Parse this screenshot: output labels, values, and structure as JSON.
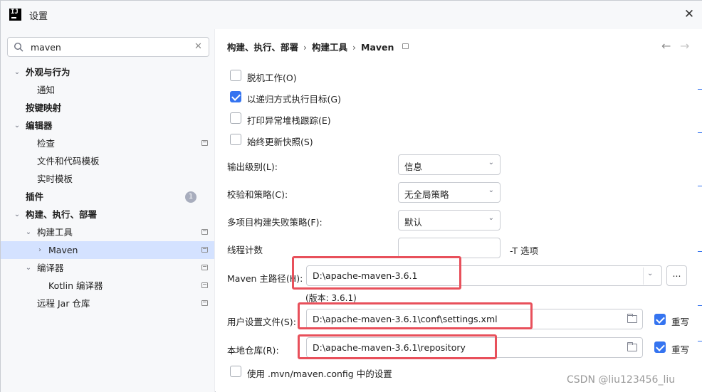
{
  "window": {
    "title": "设置",
    "logo": "IJ",
    "close_icon": "close-icon"
  },
  "search": {
    "value": "maven",
    "icon": "search-icon",
    "clear_icon": "clear-icon"
  },
  "tree": {
    "appearance": "外观与行为",
    "notifications": "通知",
    "keymap": "按键映射",
    "editor": "编辑器",
    "inspections": "检查",
    "file_templates": "文件和代码模板",
    "live_templates": "实时模板",
    "plugins": "插件",
    "plugins_badge": "1",
    "build": "构建、执行、部署",
    "build_tools": "构建工具",
    "maven": "Maven",
    "compiler": "编译器",
    "kotlin_compiler": "Kotlin 编译器",
    "remote_jar": "远程 Jar 仓库"
  },
  "breadcrumb": {
    "part1": "构建、执行、部署",
    "part2": "构建工具",
    "part3": "Maven",
    "separator": "›"
  },
  "options": {
    "offline": "脱机工作(O)",
    "recursive": "以递归方式执行目标(G)",
    "print_stack": "打印异常堆栈跟踪(E)",
    "always_update": "始终更新快照(S)",
    "use_mvn_config": "使用 .mvn/maven.config 中的设置"
  },
  "fields": {
    "output_level_label": "输出级别(L):",
    "output_level_value": "信息",
    "checksum_label": "校验和策略(C):",
    "checksum_value": "无全局策略",
    "fail_policy_label": "多项目构建失败策略(F):",
    "fail_policy_value": "默认",
    "thread_label": "线程计数",
    "thread_value": "",
    "thread_hint": "-T 选项",
    "maven_home_label": "Maven 主路径(H):",
    "maven_home_value": "D:\\apache-maven-3.6.1",
    "browse_label": "...",
    "version_text": "(版本: 3.6.1)",
    "user_settings_label": "用户设置文件(S):",
    "user_settings_value": "D:\\apache-maven-3.6.1\\conf\\settings.xml",
    "local_repo_label": "本地仓库(R):",
    "local_repo_value": "D:\\apache-maven-3.6.1\\repository",
    "override_label": "重写"
  },
  "watermark": "CSDN @liu123456_liu",
  "colors": {
    "accent": "#3574f0",
    "highlight": "#e8505b",
    "selection": "#d4e2ff"
  }
}
